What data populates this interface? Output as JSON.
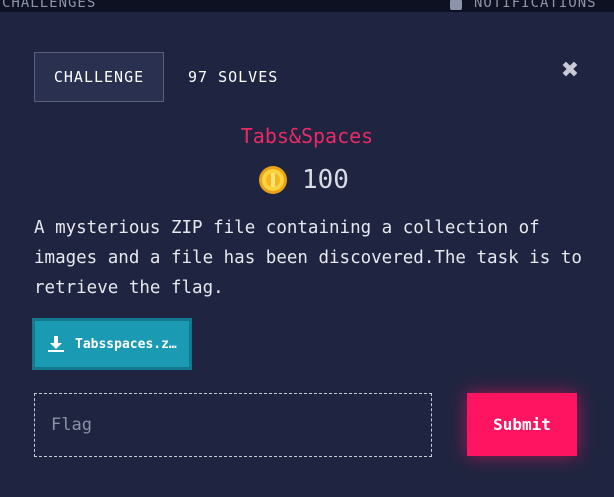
{
  "topbar": {
    "left_label": "CHALLENGES",
    "right_label": "NOTIFICATIONS"
  },
  "modal": {
    "tab_label": "CHALLENGE",
    "solves_label": "97 SOLVES",
    "close_glyph": "✖",
    "title": "Tabs&Spaces",
    "points": "100",
    "description": "A mysterious ZIP file containing a collection of images and a file has been discovered.The task is to retrieve the flag.",
    "download_label": "Tabsspaces.zip",
    "flag_placeholder": "Flag",
    "flag_value": "",
    "submit_label": "Submit"
  },
  "colors": {
    "background": "#1f2540",
    "title": "#ea2a66",
    "download": "#1a9bb3",
    "submit": "#ff1461"
  },
  "icons": {
    "coin": "coin-icon",
    "download": "download-icon",
    "close": "close-icon",
    "bell": "bell-icon"
  }
}
